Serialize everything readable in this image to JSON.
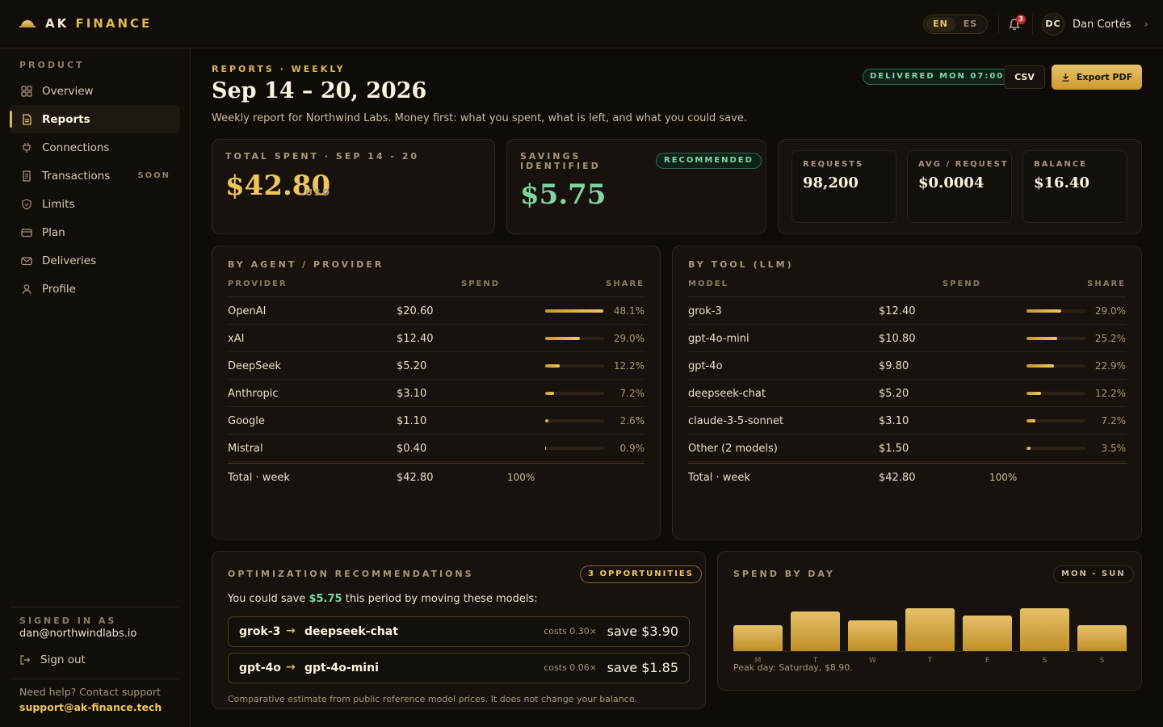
{
  "brand": {
    "name_a": "AK",
    "name_b": "FINANCE"
  },
  "topbar": {
    "languages": [
      "EN",
      "ES"
    ],
    "active_language": "EN",
    "notifications": "3",
    "user_initials": "DC",
    "user_name": "Dan Cortés"
  },
  "sidebar": {
    "section": "PRODUCT",
    "items": [
      {
        "label": "Overview",
        "icon": "grid-icon"
      },
      {
        "label": "Reports",
        "icon": "document-icon",
        "active": true
      },
      {
        "label": "Connections",
        "icon": "plug-icon"
      },
      {
        "label": "Transactions",
        "icon": "receipt-icon",
        "badge": "SOON"
      },
      {
        "label": "Limits",
        "icon": "shield-icon"
      },
      {
        "label": "Plan",
        "icon": "card-icon"
      },
      {
        "label": "Deliveries",
        "icon": "mail-icon"
      },
      {
        "label": "Profile",
        "icon": "user-icon"
      }
    ],
    "signed_in_label": "SIGNED IN AS",
    "signed_in_email": "dan@northwindlabs.io",
    "sign_out": "Sign out",
    "help": "Need help? Contact support",
    "support_email": "support@ak-finance.tech"
  },
  "header": {
    "eyebrow": "REPORTS · WEEKLY",
    "title": "Sep 14 – 20, 2026",
    "subtitle": "Weekly report for Northwind Labs. Money first: what you spent, what is left, and what you could save.",
    "delivered": "DELIVERED MON 07:00",
    "csv": "CSV",
    "export_pdf": "Export PDF"
  },
  "summary": {
    "total_label": "TOTAL SPENT · SEP 14 - 20",
    "total_value": "$42.80",
    "currency": "USD",
    "savings_label_1": "SAVINGS",
    "savings_label_2": "IDENTIFIED",
    "savings_value": "$5.75",
    "recommended": "RECOMMENDED",
    "stats": [
      {
        "label": "REQUESTS",
        "value": "98,200"
      },
      {
        "label": "AVG / REQUEST",
        "value": "$0.0004"
      },
      {
        "label": "BALANCE",
        "value": "$16.40"
      }
    ]
  },
  "by_provider": {
    "title": "BY AGENT / PROVIDER",
    "headers": [
      "PROVIDER",
      "SPEND",
      "SHARE"
    ],
    "rows": [
      {
        "name": "OpenAI",
        "spend": "$20.60",
        "share": 48.1,
        "share_label": "48.1%"
      },
      {
        "name": "xAI",
        "spend": "$12.40",
        "share": 29.0,
        "share_label": "29.0%"
      },
      {
        "name": "DeepSeek",
        "spend": "$5.20",
        "share": 12.2,
        "share_label": "12.2%"
      },
      {
        "name": "Anthropic",
        "spend": "$3.10",
        "share": 7.2,
        "share_label": "7.2%"
      },
      {
        "name": "Google",
        "spend": "$1.10",
        "share": 2.6,
        "share_label": "2.6%"
      },
      {
        "name": "Mistral",
        "spend": "$0.40",
        "share": 0.9,
        "share_label": "0.9%"
      }
    ],
    "total": {
      "name": "Total · week",
      "spend": "$42.80",
      "share": "100%"
    }
  },
  "by_tool": {
    "title": "BY TOOL (LLM)",
    "headers": [
      "MODEL",
      "SPEND",
      "SHARE"
    ],
    "rows": [
      {
        "name": "grok-3",
        "spend": "$12.40",
        "share": 29.0,
        "share_label": "29.0%"
      },
      {
        "name": "gpt-4o-mini",
        "spend": "$10.80",
        "share": 25.2,
        "share_label": "25.2%"
      },
      {
        "name": "gpt-4o",
        "spend": "$9.80",
        "share": 22.9,
        "share_label": "22.9%"
      },
      {
        "name": "deepseek-chat",
        "spend": "$5.20",
        "share": 12.2,
        "share_label": "12.2%"
      },
      {
        "name": "claude-3-5-sonnet",
        "spend": "$3.10",
        "share": 7.2,
        "share_label": "7.2%"
      },
      {
        "name": "Other (2 models)",
        "spend": "$1.50",
        "share": 3.5,
        "share_label": "3.5%"
      }
    ],
    "total": {
      "name": "Total · week",
      "spend": "$42.80",
      "share": "100%"
    }
  },
  "recommendations": {
    "title": "OPTIMIZATION RECOMMENDATIONS",
    "count": "3 OPPORTUNITIES",
    "lead_a": "You could save",
    "lead_amount": "$5.75",
    "lead_b": "this period by moving these models:",
    "swaps": [
      {
        "from": "grok-3",
        "to": "deepseek-chat",
        "costs": "costs 0.30×",
        "save": "save $3.90"
      },
      {
        "from": "gpt-4o",
        "to": "gpt-4o-mini",
        "costs": "costs 0.06×",
        "save": "save $1.85"
      }
    ],
    "footnote": "Comparative estimate from public reference model prices. It does not change your balance."
  },
  "spend_by_day": {
    "title": "SPEND BY DAY",
    "range": "MON - SUN",
    "peak": "Peak day: Saturday, $8.90."
  },
  "chart_data": {
    "type": "bar",
    "categories": [
      "M",
      "T",
      "W",
      "T",
      "F",
      "S",
      "S"
    ],
    "values": [
      5.3,
      8.2,
      6.4,
      8.8,
      7.3,
      8.9,
      5.4
    ],
    "title": "SPEND BY DAY",
    "ylim": [
      0,
      10
    ],
    "grid": false
  }
}
